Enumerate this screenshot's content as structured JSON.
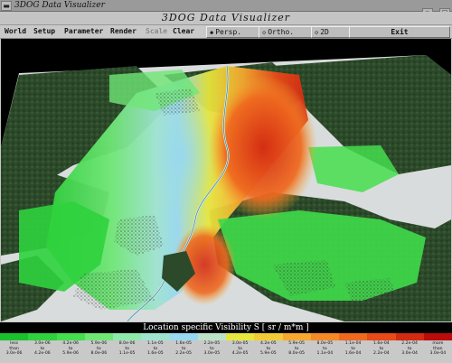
{
  "window": {
    "title": "3DOG  Data  Visualizer",
    "sysmenu_glyph": "▬",
    "minimize_glyph": "▫",
    "maximize_glyph": "□"
  },
  "app": {
    "title": "3DOG  Data  Visualizer"
  },
  "menu": {
    "world": "World",
    "setup": "Setup",
    "parameter": "Parameter",
    "render": "Render",
    "scale": "Scale",
    "clear": "Clear",
    "view_buttons": [
      {
        "label": "Persp.",
        "glyph": "◆"
      },
      {
        "label": "Ortho.",
        "glyph": "◇"
      },
      {
        "label": "2D",
        "glyph": "◇"
      }
    ],
    "exit": "Exit"
  },
  "legend": {
    "title": "Location specific Visibility S  [ sr / m*m ]",
    "colors": [
      "#19c12c",
      "#2fd13d",
      "#45de4e",
      "#6fe675",
      "#8fe9a8",
      "#9fe3cf",
      "#98d8f0",
      "#bce3c8",
      "#e6e63d",
      "#f2cc36",
      "#f5a92f",
      "#f48a27",
      "#ef6a1f",
      "#e84a18",
      "#d32a12",
      "#bb0b0b"
    ],
    "labels": [
      [
        "less",
        "than",
        "3.0e-06"
      ],
      [
        "3.0e-06",
        "to",
        "4.2e-06"
      ],
      [
        "4.2e-06",
        "to",
        "5.9e-06"
      ],
      [
        "5.9e-06",
        "to",
        "8.0e-06"
      ],
      [
        "8.0e-06",
        "to",
        "1.1e-05"
      ],
      [
        "1.1e-05",
        "to",
        "1.6e-05"
      ],
      [
        "1.6e-05",
        "to",
        "2.2e-05"
      ],
      [
        "2.2e-05",
        "to",
        "3.0e-05"
      ],
      [
        "3.0e-05",
        "to",
        "4.2e-05"
      ],
      [
        "4.2e-05",
        "to",
        "5.9e-05"
      ],
      [
        "5.9e-05",
        "to",
        "8.0e-05"
      ],
      [
        "8.0e-05",
        "to",
        "1.1e-04"
      ],
      [
        "1.1e-04",
        "to",
        "1.6e-04"
      ],
      [
        "1.6e-04",
        "to",
        "2.2e-04"
      ],
      [
        "2.2e-04",
        "to",
        "3.0e-04"
      ],
      [
        "more",
        "than",
        "3.0e-04"
      ]
    ]
  }
}
